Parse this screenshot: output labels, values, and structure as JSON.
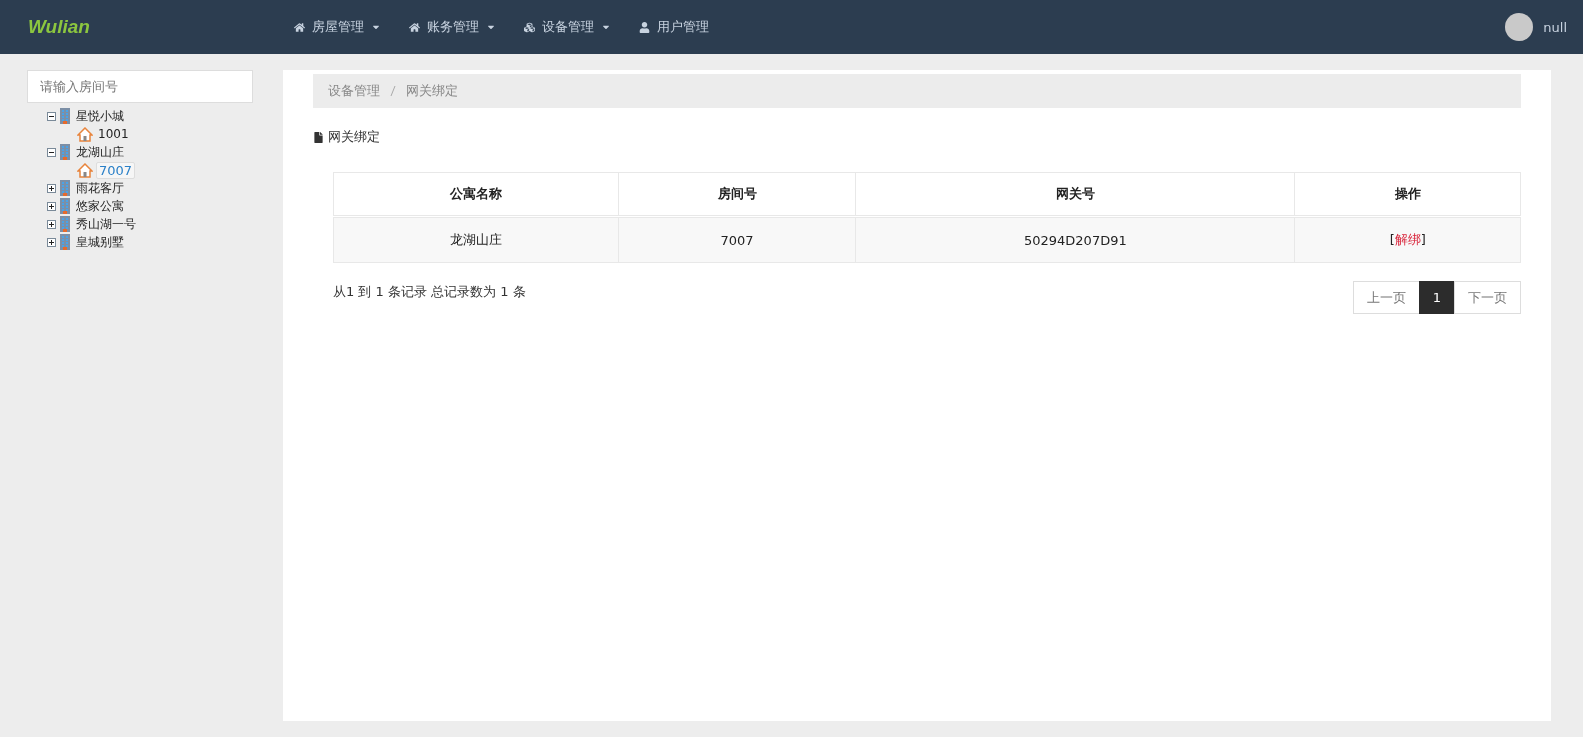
{
  "navbar": {
    "logo": "Wulian",
    "menu": [
      {
        "label": "房屋管理",
        "dropdown": true
      },
      {
        "label": "账务管理",
        "dropdown": true
      },
      {
        "label": "设备管理",
        "dropdown": true
      },
      {
        "label": "用户管理",
        "dropdown": false
      }
    ],
    "user": {
      "name": "null"
    }
  },
  "sidebar": {
    "search": {
      "placeholder": "请输入房间号"
    },
    "tree": [
      {
        "label": "星悦小城",
        "kind": "apartment",
        "expanded": true,
        "children": [
          {
            "label": "1001",
            "kind": "room",
            "selected": false
          }
        ]
      },
      {
        "label": "龙湖山庄",
        "kind": "apartment",
        "expanded": true,
        "children": [
          {
            "label": "7007",
            "kind": "room",
            "selected": true
          }
        ]
      },
      {
        "label": "雨花客厅",
        "kind": "apartment",
        "expanded": false
      },
      {
        "label": "悠家公寓",
        "kind": "apartment",
        "expanded": false
      },
      {
        "label": "秀山湖一号",
        "kind": "apartment",
        "expanded": false
      },
      {
        "label": "皇城别墅",
        "kind": "apartment",
        "expanded": false
      }
    ]
  },
  "breadcrumb": [
    "设备管理",
    "网关绑定"
  ],
  "section_title": "网关绑定",
  "table": {
    "columns": [
      "公寓名称",
      "房间号",
      "网关号",
      "操作"
    ],
    "rows": [
      {
        "cells": [
          "龙湖山庄",
          "7007",
          "50294D207D91"
        ],
        "action": {
          "open": "[",
          "label": "解绑",
          "close": "]"
        }
      }
    ]
  },
  "summary": "从1 到 1 条记录 总记录数为 1 条",
  "pagination": [
    {
      "label": "上一页",
      "selected": false
    },
    {
      "label": "1",
      "selected": true
    },
    {
      "label": "下一页",
      "selected": false
    }
  ]
}
